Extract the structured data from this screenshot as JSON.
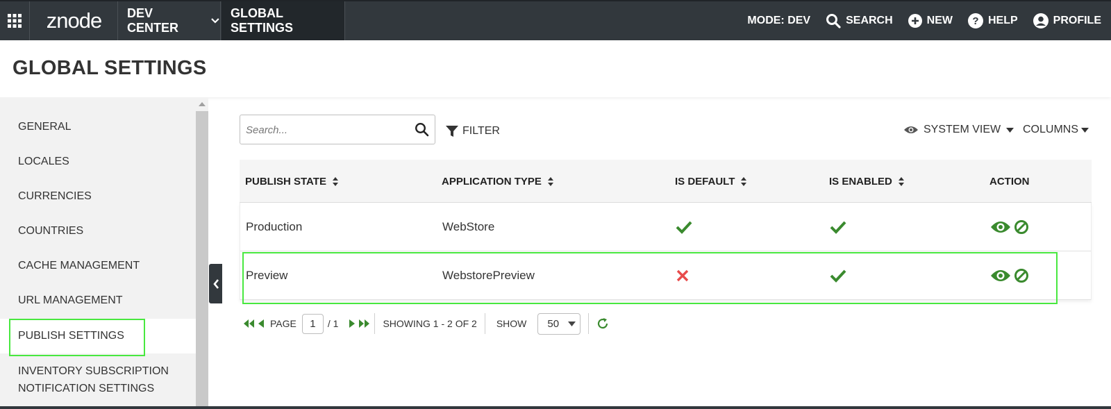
{
  "topbar": {
    "logo": "znode",
    "dev_center": "DEV CENTER",
    "global_settings": "GLOBAL SETTINGS",
    "mode": "MODE: DEV",
    "search": "SEARCH",
    "new": "NEW",
    "help": "HELP",
    "profile": "PROFILE"
  },
  "header": {
    "title": "GLOBAL SETTINGS"
  },
  "sidebar": {
    "items": [
      {
        "label": "GENERAL"
      },
      {
        "label": "LOCALES"
      },
      {
        "label": "CURRENCIES"
      },
      {
        "label": "COUNTRIES"
      },
      {
        "label": "CACHE MANAGEMENT"
      },
      {
        "label": "URL MANAGEMENT"
      },
      {
        "label": "PUBLISH SETTINGS"
      },
      {
        "label_line1": "INVENTORY SUBSCRIPTION",
        "label_line2": "NOTIFICATION SETTINGS"
      }
    ]
  },
  "toolbar": {
    "search_placeholder": "Search...",
    "filter": "FILTER",
    "system_view": "SYSTEM VIEW",
    "columns": "COLUMNS"
  },
  "table": {
    "columns": [
      "PUBLISH STATE",
      "APPLICATION TYPE",
      "IS DEFAULT",
      "IS ENABLED",
      "ACTION"
    ],
    "rows": [
      {
        "publish_state": "Production",
        "application_type": "WebStore",
        "is_default": true,
        "is_enabled": true
      },
      {
        "publish_state": "Preview",
        "application_type": "WebstorePreview",
        "is_default": false,
        "is_enabled": true
      }
    ]
  },
  "pager": {
    "page_label": "PAGE",
    "current_page": "1",
    "total_pages": "/ 1",
    "showing": "SHOWING 1 - 2 OF 2",
    "show_label": "SHOW",
    "page_size": "50"
  },
  "colors": {
    "topbar": "#32383d",
    "accent_green": "#3a8a2e",
    "error_red": "#e84b4b",
    "highlight": "#48e83f"
  }
}
